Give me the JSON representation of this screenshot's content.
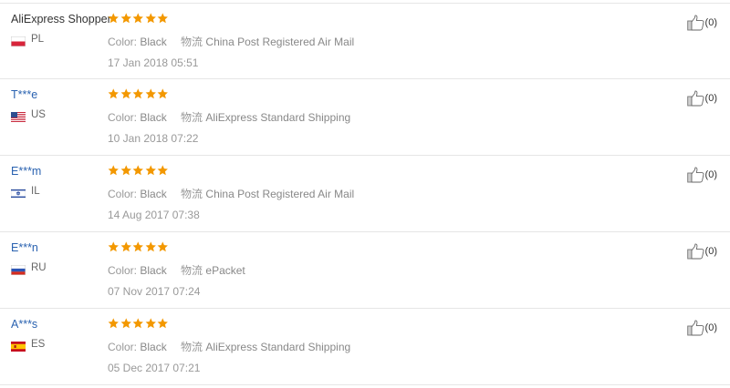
{
  "labels": {
    "color_label": "Color:",
    "shipping_label": "物流"
  },
  "rating_color": "#f39800",
  "reviews": [
    {
      "name": "AliExpress Shopper",
      "country": "PL",
      "flag": "pl-flag-icon",
      "stars": 5,
      "color": "Black",
      "shipping": "China Post Registered Air Mail",
      "time": "17 Jan 2018 05:51",
      "helpful": "(0)"
    },
    {
      "name": "T***e",
      "country": "US",
      "flag": "us-flag-icon",
      "stars": 5,
      "color": "Black",
      "shipping": "AliExpress Standard Shipping",
      "time": "10 Jan 2018 07:22",
      "helpful": "(0)"
    },
    {
      "name": "E***m",
      "country": "IL",
      "flag": "il-flag-icon",
      "stars": 5,
      "color": "Black",
      "shipping": "China Post Registered Air Mail",
      "time": "14 Aug 2017 07:38",
      "helpful": "(0)"
    },
    {
      "name": "E***n",
      "country": "RU",
      "flag": "ru-flag-icon",
      "stars": 5,
      "color": "Black",
      "shipping": "ePacket",
      "time": "07 Nov 2017 07:24",
      "helpful": "(0)"
    },
    {
      "name": "A***s",
      "country": "ES",
      "flag": "es-flag-icon",
      "stars": 5,
      "color": "Black",
      "shipping": "AliExpress Standard Shipping",
      "time": "05 Dec 2017 07:21",
      "helpful": "(0)"
    }
  ]
}
